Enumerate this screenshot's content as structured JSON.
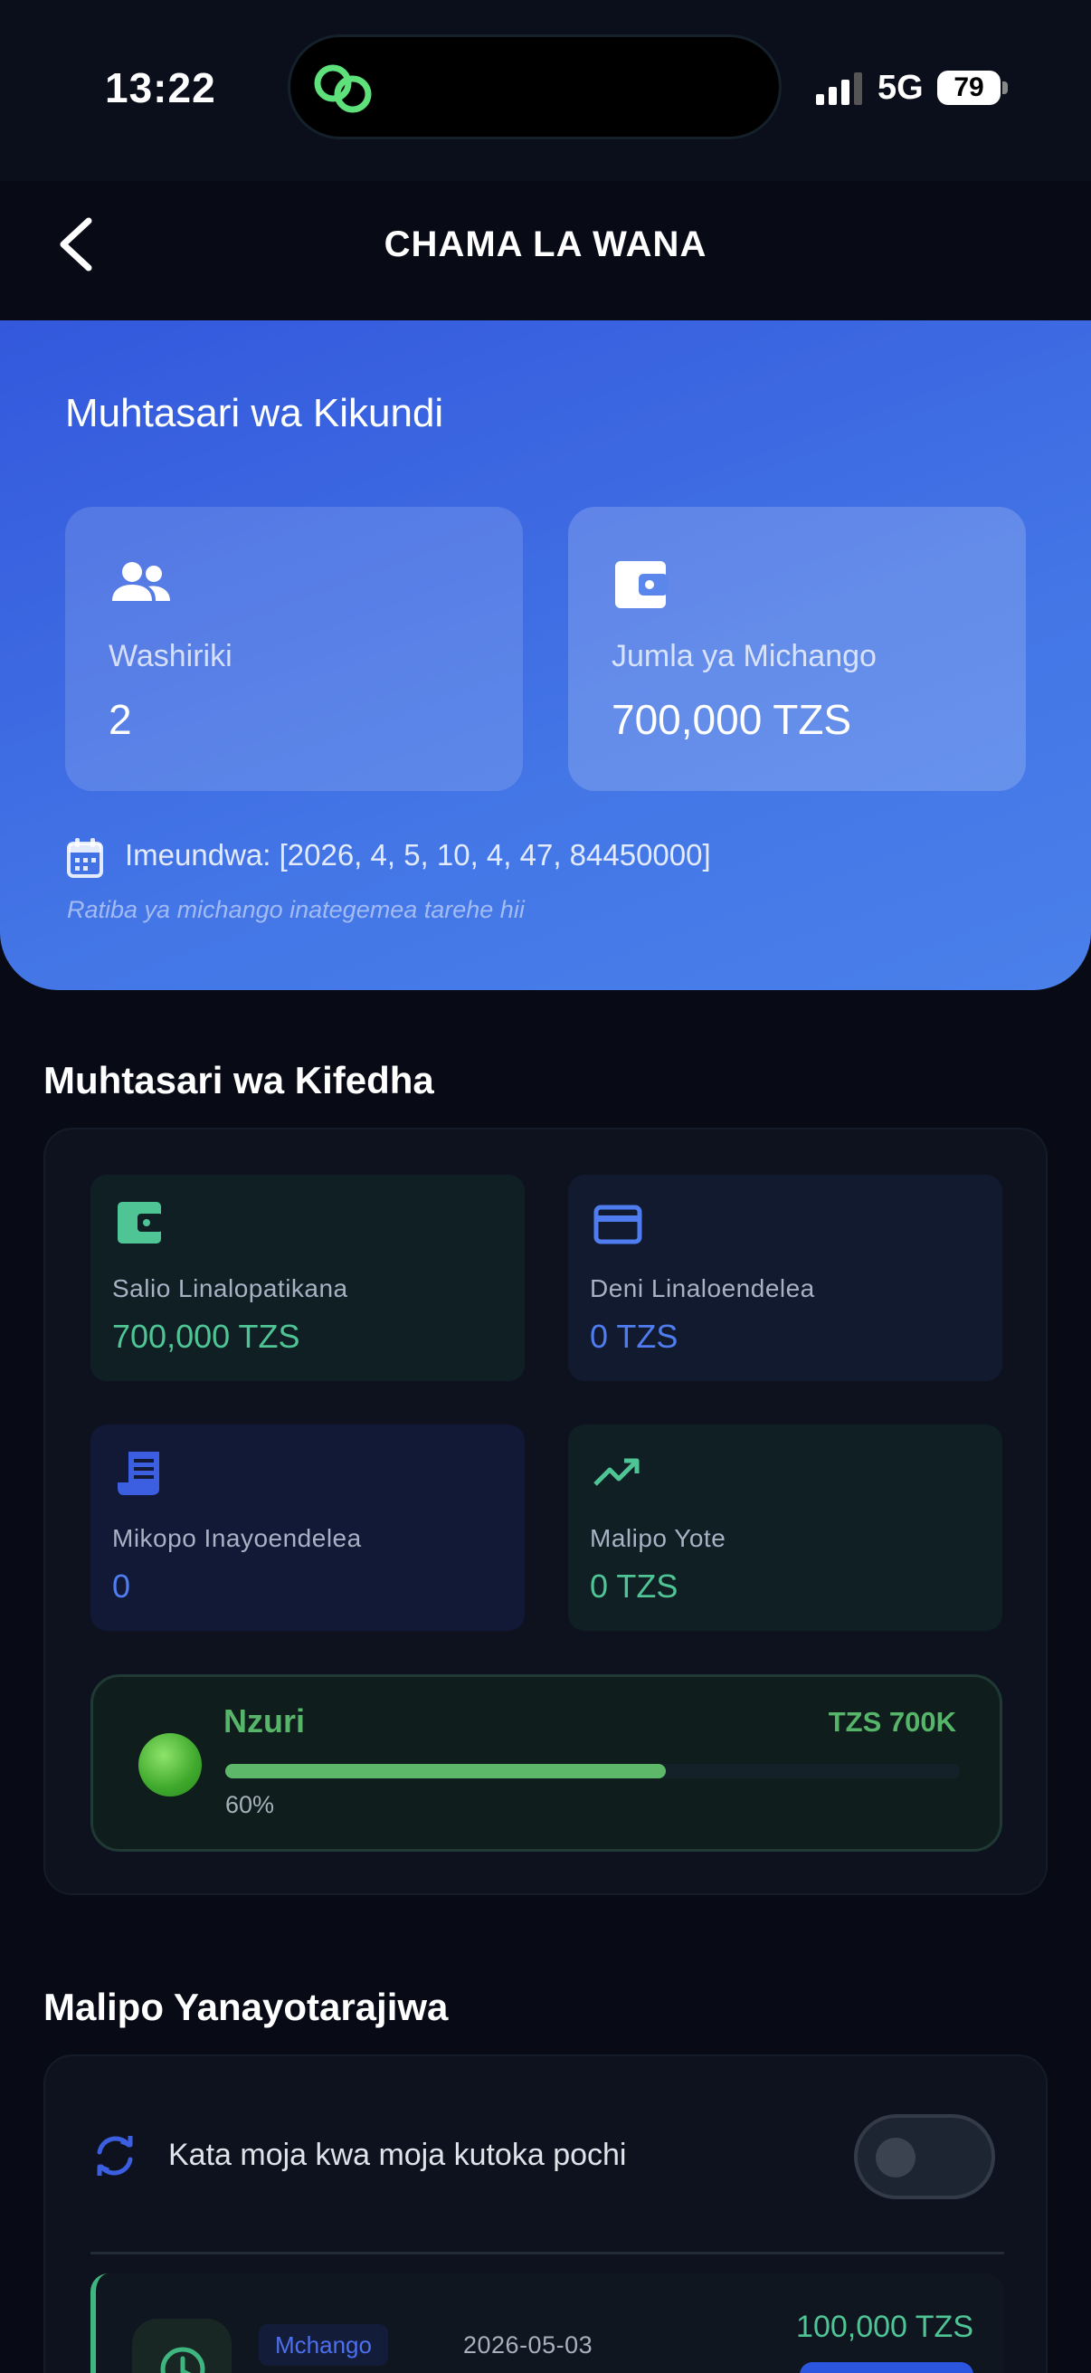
{
  "status_bar": {
    "time": "13:22",
    "network": "5G",
    "battery": "79"
  },
  "nav": {
    "title": "CHAMA LA WANA",
    "back_icon": "chevron-left-icon"
  },
  "group_summary": {
    "title": "Muhtasari wa Kikundi",
    "members": {
      "label": "Washiriki",
      "value": "2",
      "icon": "people-icon"
    },
    "contributions": {
      "label": "Jumla ya Michango",
      "value": "700,000 TZS",
      "icon": "wallet-icon"
    },
    "created_label": "Imeundwa: [2026, 4, 5, 10, 4, 47, 84450000]",
    "created_note": "Ratiba ya michango inategemea tarehe hii"
  },
  "financial_summary": {
    "title": "Muhtasari wa Kifedha",
    "tiles": [
      {
        "label": "Salio Linalopatikana",
        "value": "700,000 TZS",
        "icon": "wallet-icon"
      },
      {
        "label": "Deni Linaloendelea",
        "value": "0 TZS",
        "icon": "credit-card-icon"
      },
      {
        "label": "Mikopo Inayoendelea",
        "value": "0",
        "icon": "receipt-icon"
      },
      {
        "label": "Malipo Yote",
        "value": "0 TZS",
        "icon": "trending-up-icon"
      }
    ],
    "health": {
      "status": "Nzuri",
      "amount": "TZS 700K",
      "percent_label": "60%",
      "progress": 0.6
    }
  },
  "upcoming_payments": {
    "title": "Malipo Yanayotarajiwa",
    "auto_deduct_label": "Kata moja kwa moja kutoka pochi",
    "auto_deduct_enabled": false,
    "items": [
      {
        "type": "Mchango",
        "date": "2026-05-03",
        "amount": "100,000 TZS"
      }
    ]
  },
  "colors": {
    "accent_blue": "#4375e6",
    "success_green": "#4fc495",
    "background": "#080b16"
  }
}
